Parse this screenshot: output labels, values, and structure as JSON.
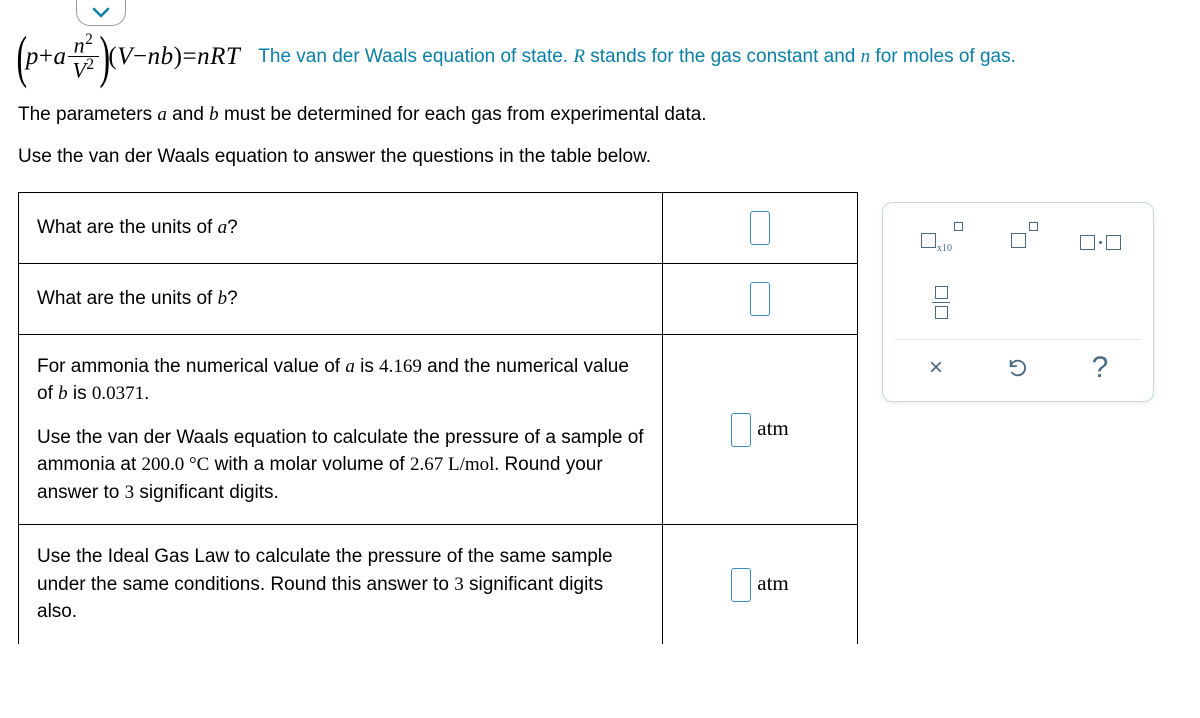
{
  "equation": {
    "desc_prefix": "The van der Waals equation of state. ",
    "R": "R",
    "desc_mid": " stands for the gas constant and ",
    "n": "n",
    "desc_suffix": " for moles of gas."
  },
  "p1_a": "The parameters ",
  "p1_b": " and ",
  "p1_c": " must be determined for each gas from experimental data.",
  "p2": "Use the van der Waals equation to answer the questions in the table below.",
  "a_sym": "a",
  "b_sym": "b",
  "rows": {
    "r1": {
      "q_pre": "What are the units of ",
      "sym": "a",
      "q_post": "?"
    },
    "r2": {
      "q_pre": "What are the units of ",
      "sym": "b",
      "q_post": "?"
    },
    "r3": {
      "line1_a": "For ammonia the numerical value of ",
      "line1_b": " is ",
      "a_val": "4.169",
      "line1_c": " and the numerical value of ",
      "line1_d": " is ",
      "b_val": "0.0371",
      "line1_e": ".",
      "line2_a": "Use the van der Waals equation to calculate the pressure of a sample of ammonia at ",
      "temp": "200.0 °C",
      "line2_b": " with a molar volume of ",
      "vol": "2.67  L/mol.",
      "line2_c": " Round your answer to ",
      "sig": "3",
      "line2_d": " significant digits.",
      "unit": "atm"
    },
    "r4": {
      "q_a": "Use the Ideal Gas Law to calculate the pressure of the same sample under the same conditions. Round this answer to ",
      "sig": "3",
      "q_b": " significant digits also.",
      "unit": "atm"
    }
  },
  "toolbox": {
    "x10": "x10",
    "times": "×",
    "reset": "↺",
    "help": "?"
  }
}
